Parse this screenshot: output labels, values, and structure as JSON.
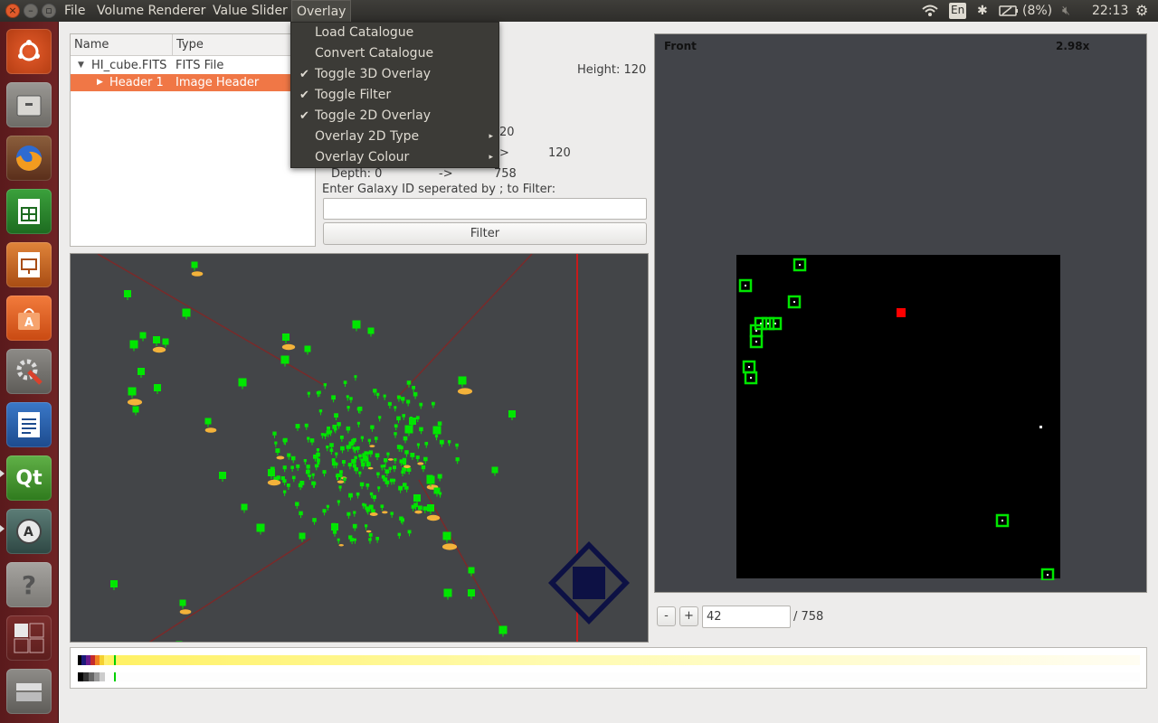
{
  "topbar": {
    "menus": [
      "File",
      "Volume Renderer",
      "Value Slider",
      "Overlay"
    ],
    "keyboard": "En",
    "battery": "(8%)",
    "time": "22:13"
  },
  "tree": {
    "headers": [
      "Name",
      "Type"
    ],
    "rows": [
      {
        "name": "HI_cube.FITS",
        "type": "FITS File"
      },
      {
        "name": "Header 1",
        "type": "Image Header"
      }
    ]
  },
  "info": {
    "height_label": "Height: 120",
    "row1_value": "20",
    "row2_arrow": ">",
    "row2_value": "120",
    "depth_label": "Depth: 0",
    "depth_arrow": "->",
    "depth_value": "758",
    "filter_prompt": "Enter Galaxy ID seperated by ; to Filter:",
    "filter_value": "",
    "filter_button": "Filter"
  },
  "overlay_menu": {
    "items": [
      {
        "label": "Load Catalogue",
        "checked": false,
        "submenu": false
      },
      {
        "label": "Convert Catalogue",
        "checked": false,
        "submenu": false
      },
      {
        "label": "Toggle 3D Overlay",
        "checked": true,
        "submenu": false
      },
      {
        "label": "Toggle Filter",
        "checked": true,
        "submenu": false
      },
      {
        "label": "Toggle 2D Overlay",
        "checked": true,
        "submenu": false
      },
      {
        "label": "Overlay 2D Type",
        "checked": false,
        "submenu": true
      },
      {
        "label": "Overlay Colour",
        "checked": false,
        "submenu": true
      }
    ],
    "check_glyph": "✔",
    "arrow_glyph": "▸"
  },
  "slice_view": {
    "view_label": "Front",
    "zoom_label": "2.98x",
    "minus_label": "-",
    "plus_label": "+",
    "slice_value": "42",
    "slice_total": "/ 758"
  },
  "colors": {
    "accent": "#f07746",
    "marker_green": "#00e600",
    "marker_red": "#ff0000",
    "viewport_bg": "#434548",
    "menu_bg": "#3c3b37"
  },
  "icons": {
    "launcher": [
      "ubuntu-logo-icon",
      "files-icon",
      "firefox-icon",
      "calc-icon",
      "impress-icon",
      "software-center-icon",
      "system-settings-icon",
      "writer-icon",
      "qt-creator-icon",
      "software-updater-icon",
      "help-icon",
      "workspace-switcher-icon",
      "trash-icon"
    ],
    "indicators": [
      "wifi-icon",
      "keyboard-icon",
      "bluetooth-icon",
      "battery-icon",
      "volume-icon",
      "gear-icon"
    ]
  }
}
